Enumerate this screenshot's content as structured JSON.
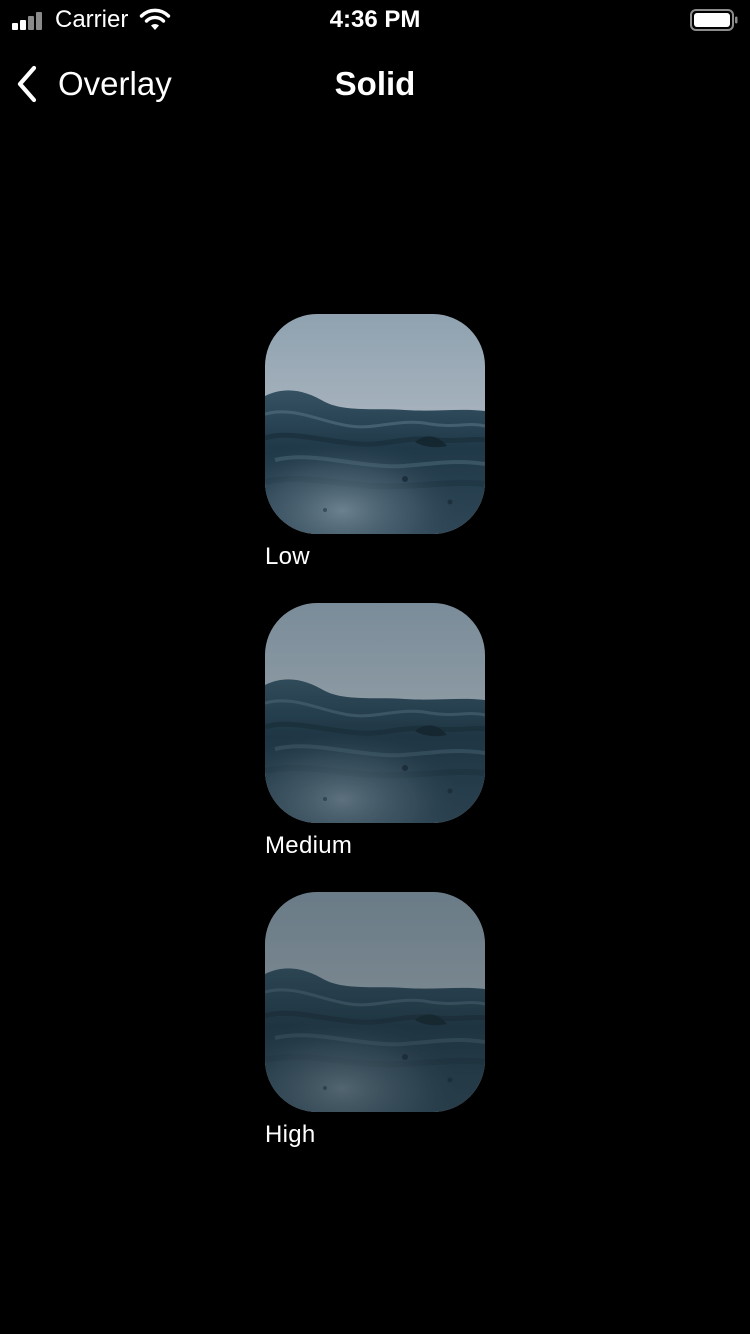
{
  "status_bar": {
    "carrier": "Carrier",
    "time": "4:36 PM",
    "signal_icon": "signal-bars-icon",
    "wifi_icon": "wifi-icon",
    "battery_icon": "battery-full-icon"
  },
  "nav": {
    "back_label": "Overlay",
    "back_icon": "chevron-left-icon",
    "title": "Solid"
  },
  "samples": [
    {
      "label": "Low"
    },
    {
      "label": "Medium"
    },
    {
      "label": "High"
    }
  ]
}
